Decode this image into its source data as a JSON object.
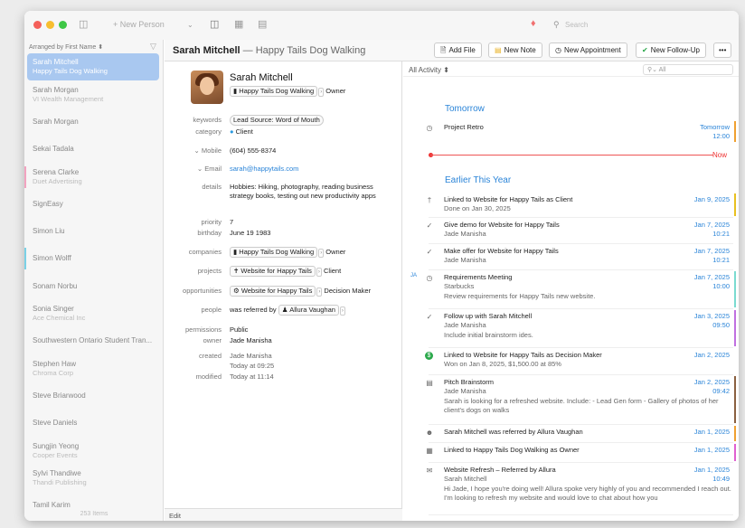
{
  "toolbar": {
    "new_person": "+ New Person",
    "search_placeholder": "Search"
  },
  "sidebar": {
    "sort_label": "Arranged by First Name ⬍",
    "count": "253 Items",
    "items": [
      {
        "name": "Sarah Mitchell",
        "sub": "Happy Tails Dog Walking",
        "selected": true
      },
      {
        "name": "Sarah Morgan",
        "sub": "VI Wealth Management"
      },
      {
        "name": "Sarah Morgan",
        "sub": ""
      },
      {
        "name": "Sekai Tadala",
        "sub": ""
      },
      {
        "name": "Serena Clarke",
        "sub": "Duet Advertising",
        "bar": "#f2a3c0"
      },
      {
        "name": "SignEasy",
        "sub": ""
      },
      {
        "name": "Simon Liu",
        "sub": ""
      },
      {
        "name": "Simon Wolff",
        "sub": "",
        "bar": "#7ad1e6"
      },
      {
        "name": "Sonam Norbu",
        "sub": ""
      },
      {
        "name": "Sonia Singer",
        "sub": "Ace Chemical Inc"
      },
      {
        "name": "Southwestern Ontario Student Tran...",
        "sub": ""
      },
      {
        "name": "Stephen Haw",
        "sub": "Chroma Corp"
      },
      {
        "name": "Steve Briarwood",
        "sub": ""
      },
      {
        "name": "Steve Daniels",
        "sub": ""
      },
      {
        "name": "Sungjin Yeong",
        "sub": "Cooper Events"
      },
      {
        "name": "Sylvi Thandiwe",
        "sub": "Thandi Publishing"
      },
      {
        "name": "Tamil Karim",
        "sub": ""
      }
    ]
  },
  "header": {
    "name": "Sarah Mitchell",
    "subtitle": " — Happy Tails Dog Walking",
    "add_file": "Add File",
    "new_note": "New Note",
    "new_appointment": "New Appointment",
    "new_followup": "New Follow-Up",
    "more": "•••"
  },
  "contact": {
    "name": "Sarah Mitchell",
    "company": "Happy Tails Dog Walking",
    "role": "Owner",
    "keywords_label": "keywords",
    "keywords": "Lead Source: Word of Mouth",
    "category_label": "category",
    "category": "Client",
    "mobile_label": "⌄ Mobile",
    "mobile": "(604) 555-8374",
    "email_label": "⌄ Email",
    "email": "sarah@happytails.com",
    "details_label": "details",
    "details": "Hobbies: Hiking, photography, reading business strategy books, testing out new productivity apps",
    "priority_label": "priority",
    "priority": "7",
    "birthday_label": "birthday",
    "birthday": "June  19  1983",
    "companies_label": "companies",
    "companies_role": "Owner",
    "projects_label": "projects",
    "project": "Website for Happy Tails",
    "project_role": "Client",
    "opps_label": "opportunities",
    "opp": "Website for Happy Tails",
    "opp_role": "Decision Maker",
    "people_label": "people",
    "people_prefix": "was referred by",
    "people": "Allura Vaughan",
    "permissions_label": "permissions",
    "permissions": "Public",
    "owner_label": "owner",
    "owner": "Jade Manisha",
    "created_label": "created",
    "created_by": "Jade Manisha",
    "created_at": "Today at 09:25",
    "modified_label": "modified",
    "modified": "Today at 11:14",
    "edit": "Edit"
  },
  "activity": {
    "filter": "All Activity ⬍",
    "search_placeholder": "All",
    "tomorrow": "Tomorrow",
    "earlier": "Earlier This Year",
    "now": "Now",
    "ja_marker": "JA",
    "rows": [
      {
        "t1": "Project Retro",
        "d1": "Tomorrow",
        "d2": "12:00",
        "icon": "◷",
        "stripe": "#f0a030"
      },
      {
        "t1": "Linked to Website for Happy Tails as Client",
        "t2": "Done on Jan 30, 2025",
        "d1": "Jan 9, 2025",
        "icon": "†",
        "stripe": "#e8c020"
      },
      {
        "t1": "Give demo for Website for Happy Tails",
        "t2": "Jade Manisha",
        "d1": "Jan 7, 2025",
        "d2": "10:21",
        "icon": "✓"
      },
      {
        "t1": "Make offer for Website for Happy Tails",
        "t2": "Jade Manisha",
        "d1": "Jan 7, 2025",
        "d2": "10:21",
        "icon": "✓"
      },
      {
        "t1": "Requirements Meeting",
        "t2": "Starbucks",
        "t3": "Review requirements for Happy Tails new website.",
        "d1": "Jan 7, 2025",
        "d2": "10:00",
        "icon": "◷",
        "stripe": "#7adbd0"
      },
      {
        "t1": "Follow up with Sarah Mitchell",
        "t2": "Jade Manisha",
        "t3": "Include initial brainstorm ides.",
        "d1": "Jan 3, 2025",
        "d2": "09:50",
        "icon": "✓",
        "stripe": "#c070e0"
      },
      {
        "t1": "Linked to Website for Happy Tails as Decision Maker",
        "t2": "Won on Jan 8, 2025, $1,500.00 at 85%",
        "d1": "Jan 2, 2025",
        "icon": "$"
      },
      {
        "t1": "Pitch Brainstorm",
        "t2": "Jade Manisha",
        "t3": "Sarah is looking for a refreshed website. Include: - Lead Gen form - Gallery of photos of her client's dogs on walks",
        "d1": "Jan 2, 2025",
        "d2": "09:42",
        "icon": "▤",
        "stripe": "#8a6040"
      },
      {
        "t1": "Sarah Mitchell was referred by Allura Vaughan",
        "d1": "Jan 1, 2025",
        "icon": "☻",
        "stripe": "#f0a030"
      },
      {
        "t1": "Linked to Happy Tails Dog Walking as Owner",
        "d1": "Jan 1, 2025",
        "icon": "▦",
        "stripe": "#e060d0"
      },
      {
        "t1": "Website Refresh – Referred by Allura",
        "t2": "Sarah Mitchell",
        "t3": "Hi Jade, I hope you're doing well! Allura spoke very highly of you and recommended I reach out. I'm looking to refresh my website and would love to chat about how you",
        "d1": "Jan 1, 2025",
        "d2": "10:49",
        "icon": "✉"
      }
    ]
  },
  "colors": {
    "accent": "#2a84d8",
    "now": "#e33",
    "selected": "#a9c8f0"
  }
}
